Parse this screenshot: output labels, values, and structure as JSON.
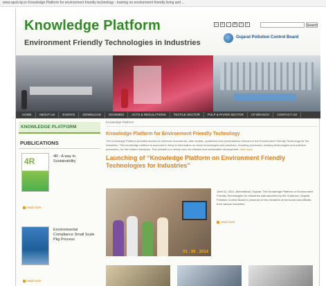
{
  "browser": {
    "url_text": "www.apcb-kp.in  Knowledge Platform for environment friendly technology · training on environment friendly living and ...",
    "top_text": "www.apcb-kp.in"
  },
  "header": {
    "title": "Knowledge Platform",
    "subtitle": "Environment Friendly Technologies in Industries",
    "search_button": "Search",
    "logo_text": "Gujarat Pollution Control Board"
  },
  "nav": {
    "items": [
      "HOME",
      "ABOUT US",
      "EVENTS",
      "DOWNLOAD",
      "SCHEMES",
      "ACTS & REGULATIONS",
      "TEXTILE SECTOR",
      "PULP & PAPER SECTOR",
      "CP BRANCH",
      "CONTACT US"
    ]
  },
  "sidebar": {
    "heading": "KNOWLEDGE PLATFORM",
    "publications_heading": "PUBLICATIONS",
    "publications": [
      {
        "cover_label": "4R",
        "title": "4R : A way to Sustainability",
        "read_more": "read more"
      },
      {
        "cover_label": "",
        "title": "Environmental Compliance Small Scale Pkg Process",
        "read_more": "read more"
      }
    ]
  },
  "main": {
    "breadcrumb": "Knowledge Platform",
    "kp_title": "Knowledge Platform for Environment Friendly Technology",
    "kp_body": "The Knowledge Platform provides access to reference documents, case studies, guidelines and presentations relevant to the Environment Friendly Technology for the Industries. This knowledge platform is expected to bring in information on clean technologies and practices, including processes, existing technologies and pollution prevention, for the related industries. This website is a virtual room for efficient and sustainable development.",
    "kp_read": "read more",
    "launch_title": "Launching of “Knowledge Platform on Environment Friendly Technologies for Industries”",
    "launch_text": "June 01, 2014, Ahmedabad, Gujarat. The Knowledge Platform on Environment Friendly Technologies for Industries was launched by the Chairman, Gujarat Pollution Control Board in presence of the members of the board and officials from various industries.",
    "launch_more": "read more",
    "photo_date": "01 . 06 . 2014"
  },
  "colors": {
    "title_green": "#2e8b21",
    "accent_orange": "#e67e22",
    "nav_bg": "#3b3b3b"
  }
}
